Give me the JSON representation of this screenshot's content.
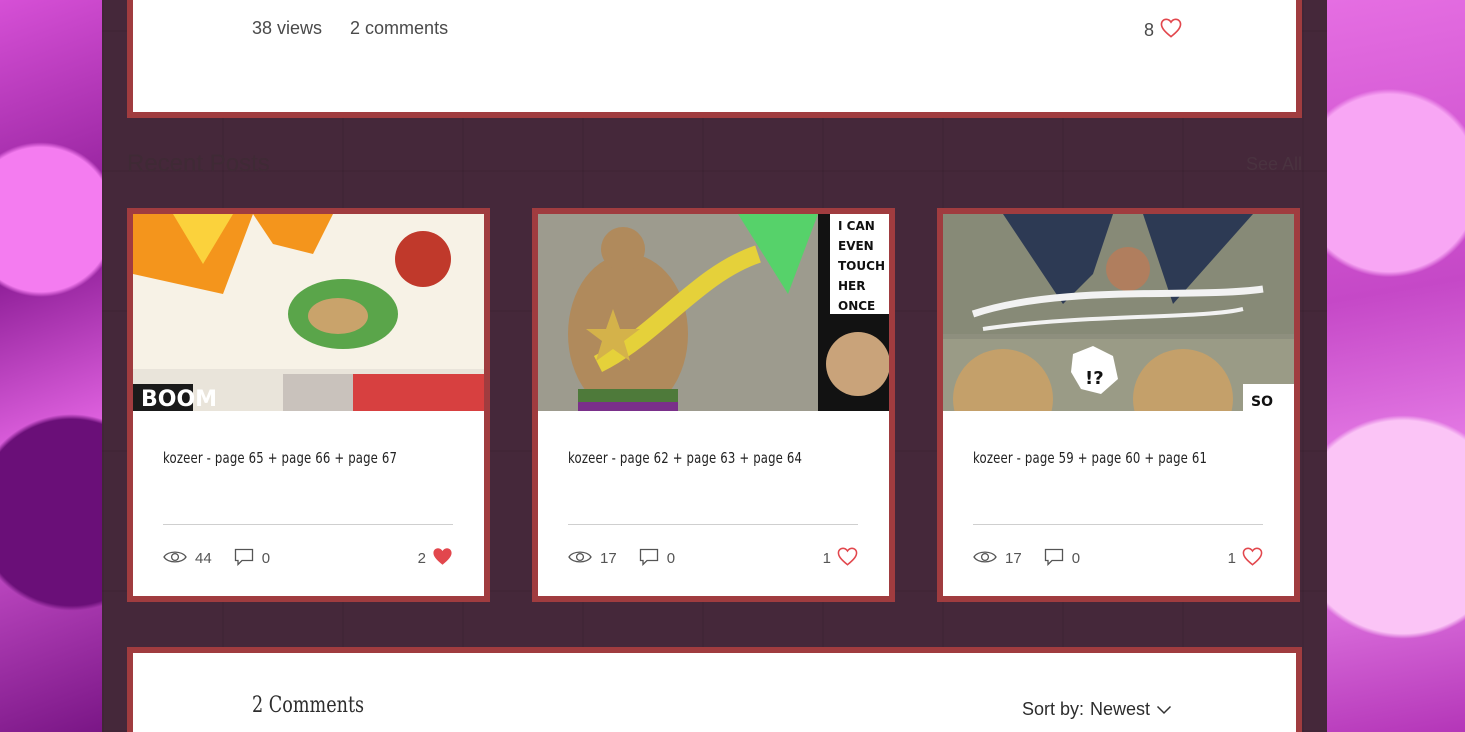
{
  "post": {
    "views": "38 views",
    "comments": "2 comments",
    "likes": "8"
  },
  "recent_posts": {
    "title": "Recent Posts",
    "see_all": "See All",
    "items": [
      {
        "title": "kozeer - page 65 + page 66 + page 67",
        "views": "44",
        "comments": "0",
        "likes": "2",
        "liked": true
      },
      {
        "title": "kozeer - page 62 + page 63 + page 64",
        "views": "17",
        "comments": "0",
        "likes": "1",
        "liked": false
      },
      {
        "title": "kozeer - page 59 + page 60 + page 61",
        "views": "17",
        "comments": "0",
        "likes": "1",
        "liked": false
      }
    ]
  },
  "comments_section": {
    "title": "2 Comments",
    "sort_label": "Sort by:",
    "sort_value": "Newest"
  },
  "colors": {
    "frame": "#a03c3f",
    "heart": "#e2474d",
    "panel_bg": "#45283a"
  },
  "icons": [
    "eye-icon",
    "comment-icon",
    "heart-outline-icon",
    "heart-filled-icon",
    "chevron-down-icon"
  ]
}
